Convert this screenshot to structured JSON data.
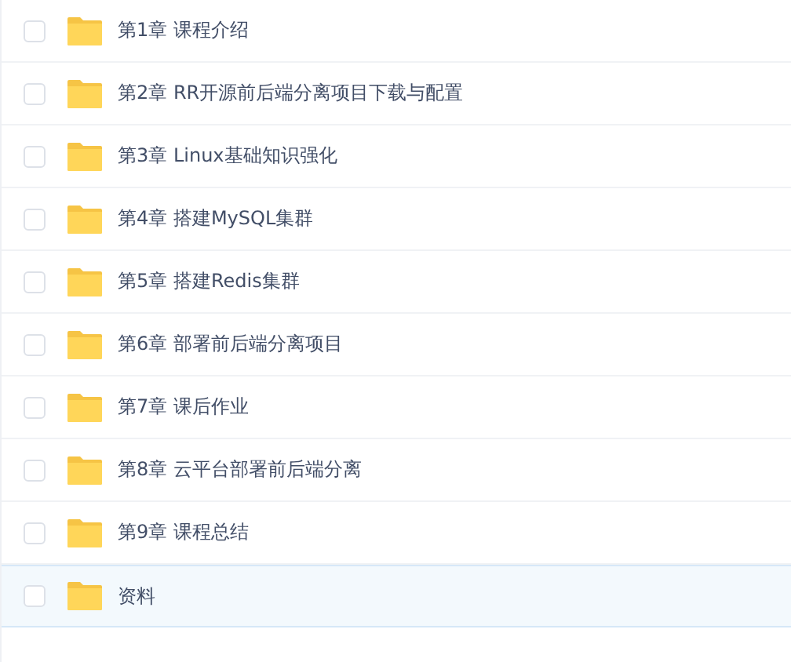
{
  "files": [
    {
      "name": "第1章 课程介绍",
      "checked": false,
      "highlighted": false
    },
    {
      "name": "第2章 RR开源前后端分离项目下载与配置",
      "checked": false,
      "highlighted": false
    },
    {
      "name": "第3章 Linux基础知识强化",
      "checked": false,
      "highlighted": false
    },
    {
      "name": "第4章 搭建MySQL集群",
      "checked": false,
      "highlighted": false
    },
    {
      "name": "第5章 搭建Redis集群",
      "checked": false,
      "highlighted": false
    },
    {
      "name": "第6章 部署前后端分离项目",
      "checked": false,
      "highlighted": false
    },
    {
      "name": "第7章 课后作业",
      "checked": false,
      "highlighted": false
    },
    {
      "name": "第8章 云平台部署前后端分离",
      "checked": false,
      "highlighted": false
    },
    {
      "name": "第9章 课程总结",
      "checked": false,
      "highlighted": false
    },
    {
      "name": "资料",
      "checked": false,
      "highlighted": true
    }
  ]
}
